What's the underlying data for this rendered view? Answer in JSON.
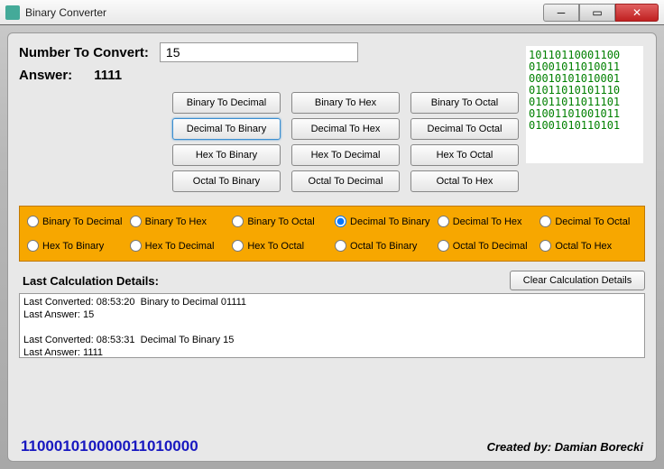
{
  "title": "Binary Converter",
  "input": {
    "label": "Number To Convert:",
    "value": "15",
    "answer_label": "Answer:",
    "answer_value": "1111"
  },
  "buttons": {
    "r0": [
      "Binary To Decimal",
      "Binary To Hex",
      "Binary To Octal"
    ],
    "r1": [
      "Decimal To Binary",
      "Decimal To Hex",
      "Decimal To Octal"
    ],
    "r2": [
      "Hex To Binary",
      "Hex To Decimal",
      "Hex To Octal"
    ],
    "r3": [
      "Octal To Binary",
      "Octal To Decimal",
      "Octal To Hex"
    ],
    "active": "Decimal To Binary"
  },
  "radios": {
    "row0": [
      "Binary To Decimal",
      "Binary To Hex",
      "Binary To Octal",
      "Decimal To Binary",
      "Decimal To Hex",
      "Decimal To Octal"
    ],
    "row1": [
      "Hex To Binary",
      "Hex To Decimal",
      "Hex To Octal",
      "Octal To Binary",
      "Octal To Decimal",
      "Octal To Hex"
    ],
    "selected": "Decimal To Binary"
  },
  "binary_art": "10110110001100\n01001011010011\n00010101010001\n01011010101110\n01011011011101\n01001101001011\n01001010110101",
  "details": {
    "header": "Last Calculation Details:",
    "clear_label": "Clear Calculation Details",
    "log": "Last Converted: 08:53:20  Binary to Decimal 01111\nLast Answer: 15\n\nLast Converted: 08:53:31  Decimal To Binary 15\nLast Answer: 1111"
  },
  "footer": {
    "binary": "110001010000011010000",
    "credit": "Created by: Damian Borecki"
  }
}
